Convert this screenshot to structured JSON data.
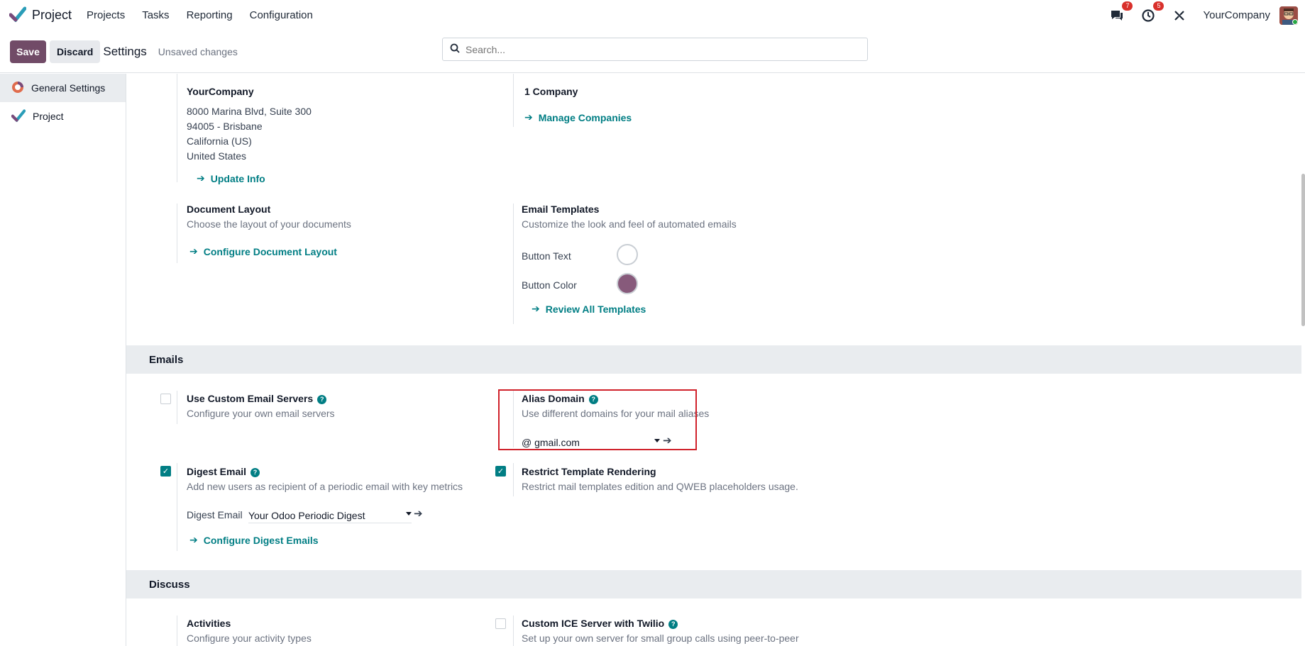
{
  "navbar": {
    "app_name": "Project",
    "menu": [
      "Projects",
      "Tasks",
      "Reporting",
      "Configuration"
    ],
    "messages_badge": "7",
    "activities_badge": "5",
    "company": "YourCompany"
  },
  "control_panel": {
    "save_label": "Save",
    "discard_label": "Discard",
    "title": "Settings",
    "status": "Unsaved changes",
    "search_placeholder": "Search..."
  },
  "sidebar": {
    "items": [
      {
        "label": "General Settings",
        "active": true
      },
      {
        "label": "Project",
        "active": false
      }
    ]
  },
  "company_block": {
    "name": "YourCompany",
    "address_lines": [
      "8000 Marina Blvd, Suite 300",
      "94005 - Brisbane",
      "California (US)",
      "United States"
    ],
    "update_link": "Update Info",
    "companies_count": "1 Company",
    "manage_link": "Manage Companies"
  },
  "document_layout": {
    "title": "Document Layout",
    "desc": "Choose the layout of your documents",
    "link": "Configure Document Layout"
  },
  "email_templates": {
    "title": "Email Templates",
    "desc": "Customize the look and feel of automated emails",
    "button_text_label": "Button Text",
    "button_text_color": "#ffffff",
    "button_color_label": "Button Color",
    "button_color": "#875a7b",
    "link": "Review All Templates"
  },
  "emails_section": {
    "header": "Emails",
    "custom_servers": {
      "title": "Use Custom Email Servers",
      "desc": "Configure your own email servers",
      "checked": false
    },
    "alias_domain": {
      "title": "Alias Domain",
      "desc": "Use different domains for your mail aliases",
      "value": "@ gmail.com"
    },
    "digest_email": {
      "title": "Digest Email",
      "desc": "Add new users as recipient of a periodic email with key metrics",
      "checked": true,
      "field_label": "Digest Email",
      "field_value": "Your Odoo Periodic Digest",
      "link": "Configure Digest Emails"
    },
    "restrict_rendering": {
      "title": "Restrict Template Rendering",
      "desc": "Restrict mail templates edition and QWEB placeholders usage.",
      "checked": true
    }
  },
  "discuss_section": {
    "header": "Discuss",
    "activities": {
      "title": "Activities",
      "desc": "Configure your activity types"
    },
    "ice_server": {
      "title": "Custom ICE Server with Twilio",
      "desc": "Set up your own server for small group calls using peer-to-peer",
      "checked": false
    }
  },
  "colors": {
    "brand": "#714b67",
    "link": "#017e84",
    "highlight": "#d0212a"
  }
}
